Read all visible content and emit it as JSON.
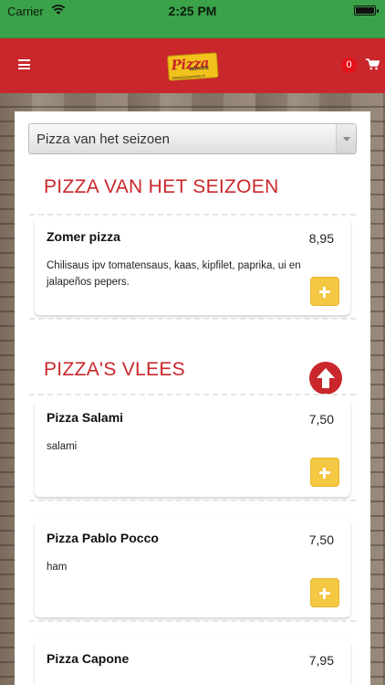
{
  "status_bar": {
    "carrier": "Carrier",
    "time": "2:25 PM"
  },
  "header": {
    "cart_count": "0",
    "logo_text": "Pizza",
    "logo_sub": "SERVICE",
    "logo_url": "www.pizzaservice.nl"
  },
  "category_select": {
    "selected": "Pizza van het seizoen"
  },
  "sections": [
    {
      "title": "PIZZA VAN HET SEIZOEN",
      "items": [
        {
          "name": "Zomer pizza",
          "price": "8,95",
          "description": "Chilisaus ipv tomatensaus, kaas, kipfilet, paprika, ui en jalapeños pepers."
        }
      ]
    },
    {
      "title": "PIZZA'S VLEES",
      "items": [
        {
          "name": "Pizza Salami",
          "price": "7,50",
          "description": "salami"
        },
        {
          "name": "Pizza Pablo Pocco",
          "price": "7,50",
          "description": "ham"
        },
        {
          "name": "Pizza Capone",
          "price": "7,95",
          "description": ""
        }
      ]
    }
  ],
  "colors": {
    "status_green": "#3aa349",
    "header_red": "#c9272b",
    "add_yellow": "#f4c842"
  },
  "icons": {
    "menu": "hamburger-menu-icon",
    "cart": "shopping-cart-icon",
    "up": "arrow-up-icon",
    "add": "plus-icon"
  }
}
